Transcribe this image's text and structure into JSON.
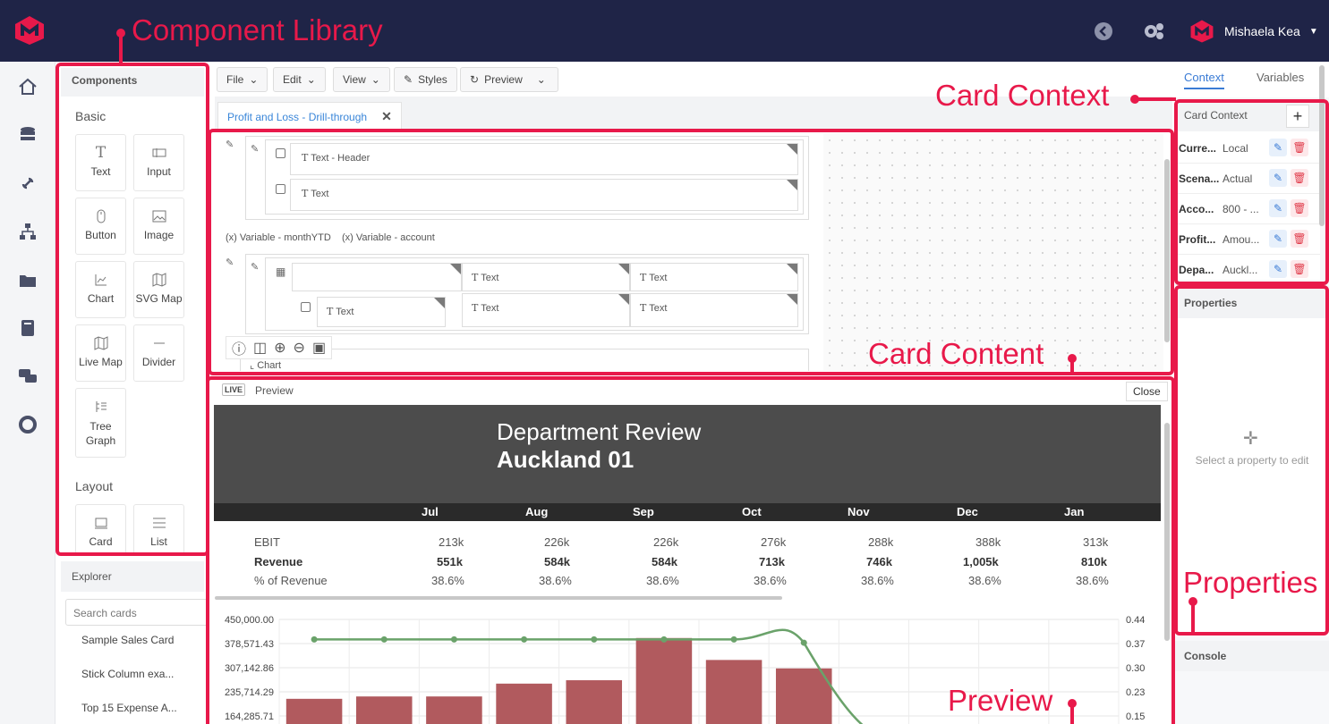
{
  "header": {
    "user_name": "Mishaela Kea",
    "logo_icon": "brand-logo-icon",
    "brand_color": "#e8194a",
    "bar_color": "#1f2447"
  },
  "left_nav": [
    "home-icon",
    "database-icon",
    "link-icon",
    "hierarchy-icon",
    "folders-icon",
    "book-icon",
    "chat-icon",
    "help-ring-icon"
  ],
  "components": {
    "title": "Components",
    "basic_label": "Basic",
    "basic": [
      "Text",
      "Input",
      "Button",
      "Image",
      "Chart",
      "SVG Map",
      "Live Map",
      "Divider",
      "Tree Graph"
    ],
    "layout_label": "Layout",
    "layout": [
      "Card",
      "List"
    ]
  },
  "explorer": {
    "title": "Explorer",
    "search_placeholder": "Search cards",
    "items": [
      "Sample Sales Card",
      "Stick Column exa...",
      "Top 15 Expense A..."
    ]
  },
  "toolbar": {
    "file": "File",
    "edit": "Edit",
    "view": "View",
    "styles": "Styles",
    "preview": "Preview"
  },
  "tab": {
    "label": "Profit and Loss - Drill-through"
  },
  "canvas": {
    "text_header": "Text - Header",
    "text": "Text",
    "var1": "Variable - monthYTD",
    "var2": "Variable - account",
    "chart": "Chart"
  },
  "preview": {
    "live": "LIVE",
    "label": "Preview",
    "close": "Close",
    "title": "Department Review",
    "subtitle": "Auckland 01",
    "months": [
      "Jul",
      "Aug",
      "Sep",
      "Oct",
      "Nov",
      "Dec",
      "Jan"
    ],
    "rows": [
      {
        "label": "EBIT",
        "values": [
          "213k",
          "226k",
          "226k",
          "276k",
          "288k",
          "388k",
          "313k"
        ]
      },
      {
        "label": "Revenue",
        "values": [
          "551k",
          "584k",
          "584k",
          "713k",
          "746k",
          "1,005k",
          "810k"
        ]
      },
      {
        "label": "% of Revenue",
        "values": [
          "38.6%",
          "38.6%",
          "38.6%",
          "38.6%",
          "38.6%",
          "38.6%",
          "38.6%"
        ]
      }
    ]
  },
  "chart_data": {
    "type": "bar",
    "left_ticks": [
      "450,000.00",
      "378,571.43",
      "307,142.86",
      "235,714.29",
      "164,285.71"
    ],
    "right_ticks": [
      "0.44",
      "0.37",
      "0.30",
      "0.23",
      "0.15"
    ],
    "ylim": [
      164285.71,
      450000
    ],
    "y2lim": [
      0.15,
      0.44
    ],
    "series": [
      {
        "type": "bar",
        "values": [
          215000,
          222000,
          222000,
          260000,
          270000,
          395000,
          330000,
          305000
        ],
        "color": "#b15a5e"
      },
      {
        "type": "line",
        "values": [
          0.38,
          0.38,
          0.38,
          0.38,
          0.38,
          0.38,
          0.38,
          0.37,
          0.1
        ],
        "color": "#6aa26a"
      }
    ]
  },
  "context": {
    "tab_context": "Context",
    "tab_variables": "Variables",
    "title": "Card Context",
    "add": "+",
    "rows": [
      {
        "key": "Curre...",
        "value": "Local"
      },
      {
        "key": "Scena...",
        "value": "Actual"
      },
      {
        "key": "Acco...",
        "value": "800 - ..."
      },
      {
        "key": "Profit...",
        "value": "Amou..."
      },
      {
        "key": "Depa...",
        "value": "Auckl..."
      }
    ]
  },
  "properties": {
    "title": "Properties",
    "empty": "Select a property to edit"
  },
  "console": {
    "title": "Console"
  },
  "annotations": {
    "component_library": "Component Library",
    "card_context": "Card Context",
    "card_content": "Card Content",
    "properties": "Properties",
    "preview": "Preview"
  }
}
